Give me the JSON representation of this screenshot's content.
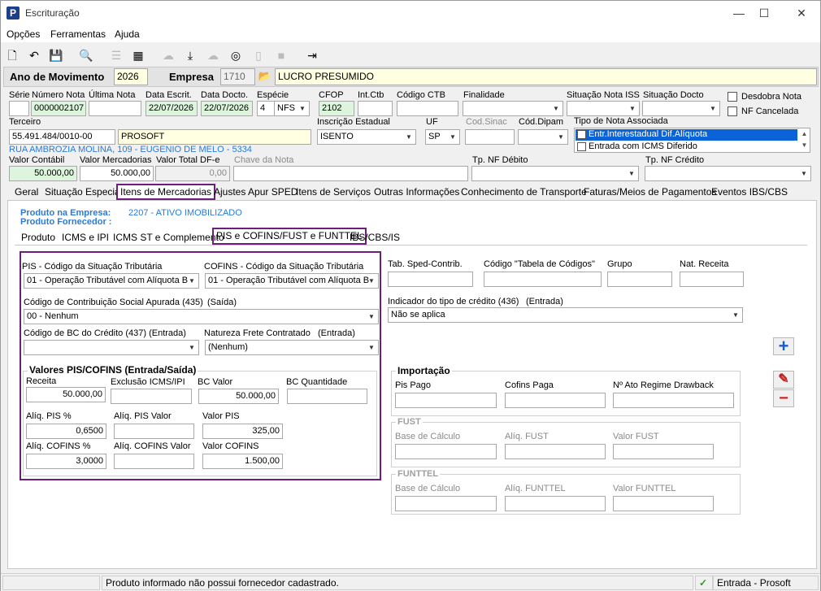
{
  "window": {
    "title": "Escrituração",
    "min": "—",
    "max": "☐",
    "close": "✕"
  },
  "menu": [
    "Opções",
    "Ferramentas",
    "Ajuda"
  ],
  "header": {
    "ano_label": "Ano de Movimento",
    "ano": "2026",
    "empresa_label": "Empresa",
    "empresa_code": "1710",
    "empresa_name": "LUCRO PRESUMIDO"
  },
  "nota": {
    "serie_label": "Série",
    "serie": "",
    "numero_label": "Número Nota",
    "numero": "0000002107",
    "ultima_label": "Última Nota",
    "ultima": "",
    "data_escrit_label": "Data Escrit.",
    "data_escrit": "22/07/2026",
    "data_docto_label": "Data Docto.",
    "data_docto": "22/07/2026",
    "especie_label": "Espécie",
    "especie_num": "4",
    "especie": "NFS",
    "cfop_label": "CFOP",
    "cfop": "2102",
    "intctb_label": "Int.Ctb",
    "intctb": "",
    "codctb_label": "Código CTB",
    "codctb": "",
    "finalidade_label": "Finalidade",
    "finalidade": "",
    "sit_iss_label": "Situação Nota ISS",
    "sit_iss": "",
    "sit_docto_label": "Situação Docto",
    "sit_docto": "",
    "desdobra_label": "Desdobra Nota",
    "cancelada_label": "NF Cancelada",
    "terceiro_label": "Terceiro",
    "terceiro_cnpj": "55.491.484/0010-00",
    "terceiro_nome": "PROSOFT",
    "endereco": "RUA AMBROZIA MOLINA, 109 - EUGENIO DE MELO - 5334",
    "ie_label": "Inscrição Estadual",
    "ie": "ISENTO",
    "uf_label": "UF",
    "uf": "SP",
    "codsinac_label": "Cod.Sinac",
    "coddipam_label": "Cód.Dipam",
    "tipo_assoc_label": "Tipo de Nota Associada",
    "tipo_assoc_items": [
      "Entr.Interestadual Dif.Alíquota",
      "Entrada com ICMS Diferido"
    ],
    "valor_contabil_label": "Valor Contábil",
    "valor_contabil": "50.000,00",
    "valor_merc_label": "Valor Mercadorias",
    "valor_merc": "50.000,00",
    "valor_dfe_label": "Valor Total DF-e",
    "valor_dfe": "0,00",
    "chave_label": "Chave da Nota",
    "tp_debito_label": "Tp. NF Débito",
    "tp_credito_label": "Tp. NF Crédito"
  },
  "tabs_main": [
    "Geral",
    "Situação Especial",
    "Itens de Mercadorias",
    "Ajustes Apur SPED",
    "Itens de Serviços",
    "Outras Informações",
    "Conhecimento de Transporte",
    "Faturas/Meios de Pagamentos",
    "Eventos IBS/CBS"
  ],
  "produto": {
    "empresa_label": "Produto na Empresa:",
    "empresa_value": "2207 - ATIVO IMOBILIZADO",
    "fornecedor_label": "Produto Fornecedor :"
  },
  "tabs_sub": [
    "Produto",
    "ICMS e IPI",
    "ICMS ST e Complemento",
    "PIS e COFINS/FUST e FUNTTEL",
    "IBS/CBS/IS"
  ],
  "pis": {
    "pis_cst_label": "PIS - Código da Situação Tributária",
    "pis_cst": "01 - Operação Tributável com Alíquota B",
    "cofins_cst_label": "COFINS - Código da Situação Tributária",
    "cofins_cst": "01 - Operação Tributável com Alíquota B",
    "csa_label": "Código de Contribuição Social Apurada (435)",
    "csa_suffix": "(Saída)",
    "csa": "00 - Nenhum",
    "bc_credito_label": "Código de BC do Crédito (437) (Entrada)",
    "bc_credito": "",
    "nat_frete_label": "Natureza Frete Contratado",
    "nat_frete_suffix": "(Entrada)",
    "nat_frete": "(Nenhum)",
    "valores_title": "Valores PIS/COFINS (Entrada/Saída)",
    "receita_label": "Receita",
    "receita": "50.000,00",
    "exclusao_label": "Exclusão ICMS/IPI",
    "exclusao": "",
    "bc_valor_label": "BC Valor",
    "bc_valor": "50.000,00",
    "bc_qtd_label": "BC Quantidade",
    "bc_qtd": "",
    "aliq_pis_label": "Alíq. PIS %",
    "aliq_pis": "0,6500",
    "aliq_pis_valor_label": "Alíq. PIS Valor",
    "aliq_pis_valor": "",
    "valor_pis_label": "Valor PIS",
    "valor_pis": "325,00",
    "aliq_cofins_label": "Alíq. COFINS %",
    "aliq_cofins": "3,0000",
    "aliq_cofins_valor_label": "Alíq. COFINS Valor",
    "aliq_cofins_valor": "",
    "valor_cofins_label": "Valor COFINS",
    "valor_cofins": "1.500,00"
  },
  "right": {
    "tab_sped_label": "Tab. Sped-Contrib.",
    "cod_tabela_label": "Código \"Tabela de Códigos\"",
    "grupo_label": "Grupo",
    "nat_receita_label": "Nat. Receita",
    "indicador_label": "Indicador do tipo de crédito (436)",
    "indicador_suffix": "(Entrada)",
    "indicador": "Não se aplica",
    "importacao_title": "Importação",
    "pis_pago_label": "Pis Pago",
    "cofins_paga_label": "Cofins Paga",
    "drawback_label": "Nº Ato Regime Drawback",
    "fust_title": "FUST",
    "fust_base_label": "Base de Cálculo",
    "fust_aliq_label": "Alíq. FUST",
    "fust_valor_label": "Valor FUST",
    "funttel_title": "FUNTTEL",
    "funttel_base_label": "Base de Cálculo",
    "funttel_aliq_label": "Alíq. FUNTTEL",
    "funttel_valor_label": "Valor FUNTTEL"
  },
  "status": {
    "message": "Produto informado não possui fornecedor cadastrado.",
    "mode": "Entrada - Prosoft"
  },
  "colors": {
    "accent_purple": "#6b1e7a",
    "label_blue": "#2a7ad6",
    "green_field": "#dcf5dc",
    "yellow_field": "#ffffe1"
  }
}
